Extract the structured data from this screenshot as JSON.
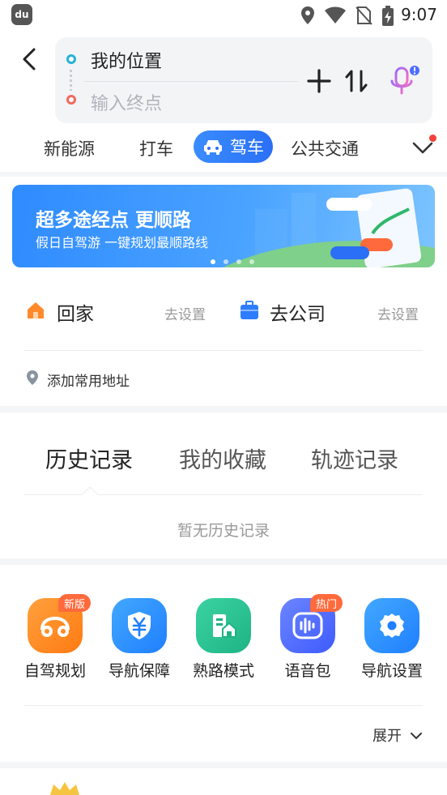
{
  "status_bar": {
    "app_badge": "du",
    "time": "9:07"
  },
  "search": {
    "from_value": "我的位置",
    "to_placeholder": "输入终点"
  },
  "mode_tabs": [
    {
      "label": "新能源"
    },
    {
      "label": "打车"
    },
    {
      "label": "驾车",
      "active": true
    },
    {
      "label": "公共交通"
    }
  ],
  "banner": {
    "title": "超多途经点 更顺路",
    "subtitle": "假日自驾游 一键规划最顺路线",
    "page_count": 4,
    "current_page": 1
  },
  "quick_places": [
    {
      "label": "回家",
      "action": "去设置",
      "icon": "home-icon"
    },
    {
      "label": "去公司",
      "action": "去设置",
      "icon": "briefcase-icon"
    }
  ],
  "add_address": "添加常用地址",
  "history_tabs": [
    {
      "label": "历史记录",
      "active": true
    },
    {
      "label": "我的收藏"
    },
    {
      "label": "轨迹记录"
    }
  ],
  "empty_hint": "暂无历史记录",
  "tools": [
    {
      "label": "自驾规划",
      "badge": "新版",
      "icon": "car-route-icon",
      "color": "#ff8a1f"
    },
    {
      "label": "导航保障",
      "badge": "",
      "icon": "shield-yen-icon",
      "color": "#1f8fff"
    },
    {
      "label": "熟路模式",
      "badge": "",
      "icon": "building-icon",
      "color": "#26c28e"
    },
    {
      "label": "语音包",
      "badge": "热门",
      "icon": "voice-wave-icon",
      "color": "#4f6cff"
    },
    {
      "label": "导航设置",
      "badge": "",
      "icon": "gear-icon",
      "color": "#1f8fff"
    }
  ],
  "expand_label": "展开",
  "colors": {
    "accent": "#2a6ff5",
    "badge": "#ff6a3d",
    "red_dot": "#f0413a"
  }
}
